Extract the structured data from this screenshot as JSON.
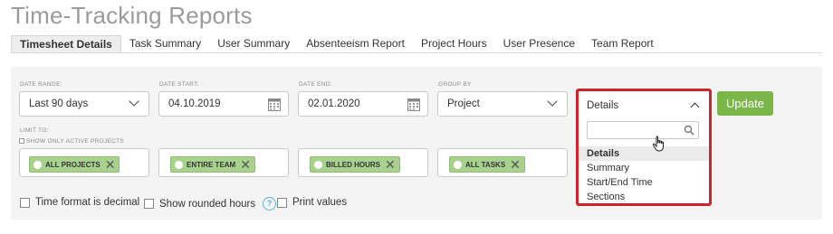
{
  "title": "Time-Tracking Reports",
  "tabs": [
    {
      "label": "Timesheet Details",
      "active": true
    },
    {
      "label": "Task Summary"
    },
    {
      "label": "User Summary"
    },
    {
      "label": "Absenteeism Report"
    },
    {
      "label": "Project Hours"
    },
    {
      "label": "User Presence"
    },
    {
      "label": "Team Report"
    }
  ],
  "filters": {
    "date_range": {
      "label": "DATE RANGE:",
      "value": "Last 90 days"
    },
    "date_start": {
      "label": "DATE START:",
      "value": "04.10.2019"
    },
    "date_end": {
      "label": "DATE END:",
      "value": "02.01.2020"
    },
    "group_by": {
      "label": "GROUP BY",
      "value": "Project"
    }
  },
  "view_dropdown": {
    "selected": "Details",
    "search_placeholder": "",
    "options": [
      "Details",
      "Summary",
      "Start/End Time",
      "Sections"
    ]
  },
  "update_label": "Update",
  "limit": {
    "label": "LIMIT TO:",
    "active_only_label": "SHOW ONLY ACTIVE PROJECTS",
    "chips": [
      "ALL PROJECTS",
      "ENTIRE TEAM",
      "BILLED HOURS",
      "ALL TASKS"
    ]
  },
  "options": {
    "decimal": "Time format is decimal",
    "rounded": "Show rounded hours",
    "help": "?",
    "print": "Print values"
  },
  "colors": {
    "accent_green": "#7ab648",
    "chip_green": "#a9d18e",
    "highlight_red": "#d0242b",
    "help_blue": "#5ab4d6"
  }
}
